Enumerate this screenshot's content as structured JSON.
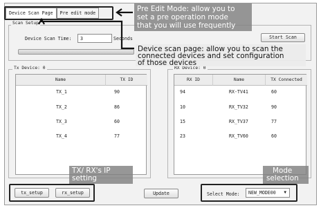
{
  "tabs": {
    "device_scan_page": "Device Scan Page",
    "pre_edit_mode": "Pre edit mode"
  },
  "scan_setup": {
    "legend": "Scan Setup",
    "time_label": "Device Scan Time:",
    "time_value": "3",
    "unit": "Seconds",
    "start_label": "Start Scan"
  },
  "tx_panel": {
    "legend": "Tx Device: 0",
    "columns": [
      "Name",
      "TX ID"
    ],
    "rows": [
      [
        "TX_1",
        "90"
      ],
      [
        "TX_2",
        "86"
      ],
      [
        "TX_3",
        "60"
      ],
      [
        "TX_4",
        "77"
      ]
    ]
  },
  "rx_panel": {
    "legend": "RX Device: 0",
    "columns": [
      "RX ID",
      "Name",
      "TX Connected"
    ],
    "rows": [
      [
        "94",
        "RX-TV41",
        "60"
      ],
      [
        "10",
        "RX_TV32",
        "90"
      ],
      [
        "15",
        "RX_TV37",
        "77"
      ],
      [
        "23",
        "RX_TV60",
        "60"
      ]
    ]
  },
  "footer": {
    "tx_setup": "tx_setup",
    "rx_setup": "rx_setup",
    "update": "Update",
    "select_mode_label": "Select Mode:",
    "select_mode_value": "NEW_MODE00"
  },
  "callouts": {
    "pre_edit": [
      "Pre Edit Mode: allow you to",
      "set a pre operation mode",
      "that you will use frequently"
    ],
    "scan_page": [
      "Device scan page:  allow you to scan the",
      "connected devices and set configuration",
      "of those devices"
    ],
    "ip_setting": [
      "TX/ RX's IP",
      "setting"
    ],
    "mode": [
      "Mode",
      "selection"
    ]
  }
}
